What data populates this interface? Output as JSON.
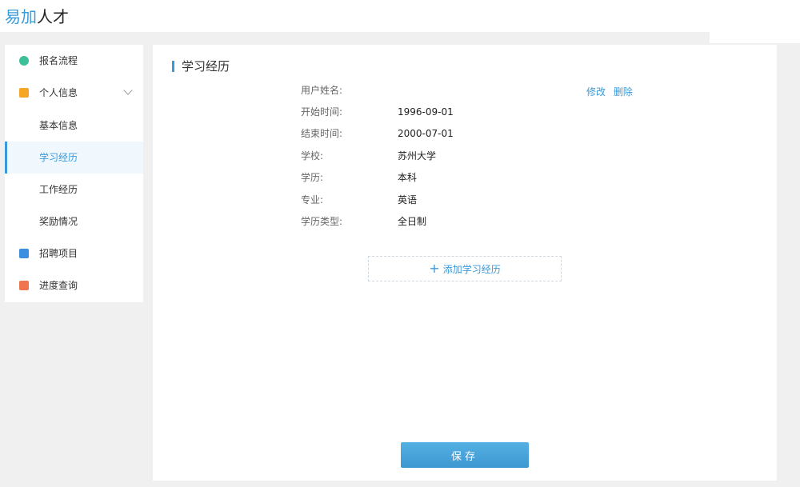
{
  "app": {
    "logo_part1": "易加",
    "logo_part2": "人才"
  },
  "sidebar": {
    "items": [
      {
        "label": "报名流程",
        "icon": "clock-circle-icon"
      },
      {
        "label": "个人信息",
        "icon": "user-card-icon"
      },
      {
        "label": "基本信息"
      },
      {
        "label": "学习经历"
      },
      {
        "label": "工作经历"
      },
      {
        "label": "奖励情况"
      },
      {
        "label": "招聘项目",
        "icon": "document-icon"
      },
      {
        "label": "进度查询",
        "icon": "search-document-icon"
      }
    ]
  },
  "main": {
    "title": "学习经历",
    "actions": {
      "edit": "修改",
      "delete": "删除"
    },
    "fields": [
      {
        "key": "用户姓名:",
        "value": ""
      },
      {
        "key": "开始时间:",
        "value": "1996-09-01"
      },
      {
        "key": "结束时间:",
        "value": "2000-07-01"
      },
      {
        "key": "学校:",
        "value": "苏州大学"
      },
      {
        "key": "学历:",
        "value": "本科"
      },
      {
        "key": "专业:",
        "value": "英语"
      },
      {
        "key": "学历类型:",
        "value": "全日制"
      }
    ],
    "add_label": "添加学习经历",
    "save_label": "保存"
  },
  "colors": {
    "accent": "#3a9ad9",
    "active_bg": "#f1f8fd"
  }
}
